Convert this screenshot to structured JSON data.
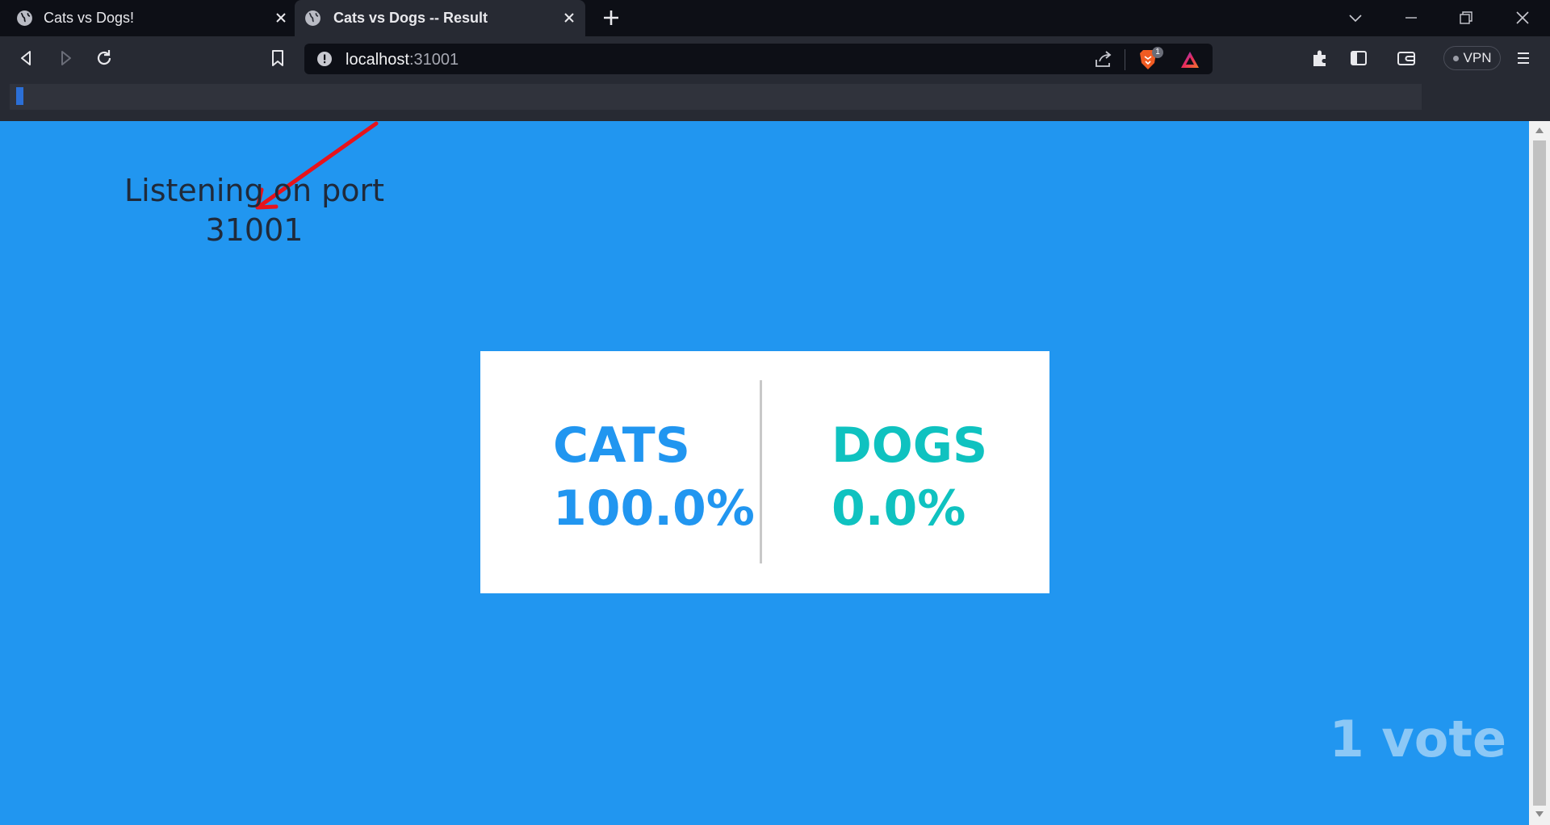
{
  "browser": {
    "tabs": [
      {
        "title": "Cats vs Dogs!",
        "active": false
      },
      {
        "title": "Cats vs Dogs -- Result",
        "active": true
      }
    ],
    "url": {
      "host": "localhost",
      "port": ":31001"
    },
    "vpn_label": "VPN",
    "shields_badge": "1",
    "find_query": ""
  },
  "annotation": {
    "text": "Listening on port 31001",
    "color": "#e8131b"
  },
  "results": {
    "cats": {
      "label": "CATS",
      "percent": "100.0%",
      "color": "#2196f0"
    },
    "dogs": {
      "label": "DOGS",
      "percent": "0.0%",
      "color": "#0fc2c0"
    },
    "votes": "1 vote"
  },
  "icons": [
    "globe-icon",
    "close-icon",
    "plus-icon",
    "chevron-down-icon",
    "minimize-icon",
    "restore-icon",
    "back-icon",
    "forward-icon",
    "reload-icon",
    "bookmark-icon",
    "info-icon",
    "share-icon",
    "brave-shields-icon",
    "brave-rewards-icon",
    "extensions-icon",
    "sidebar-icon",
    "wallet-icon",
    "menu-icon"
  ]
}
